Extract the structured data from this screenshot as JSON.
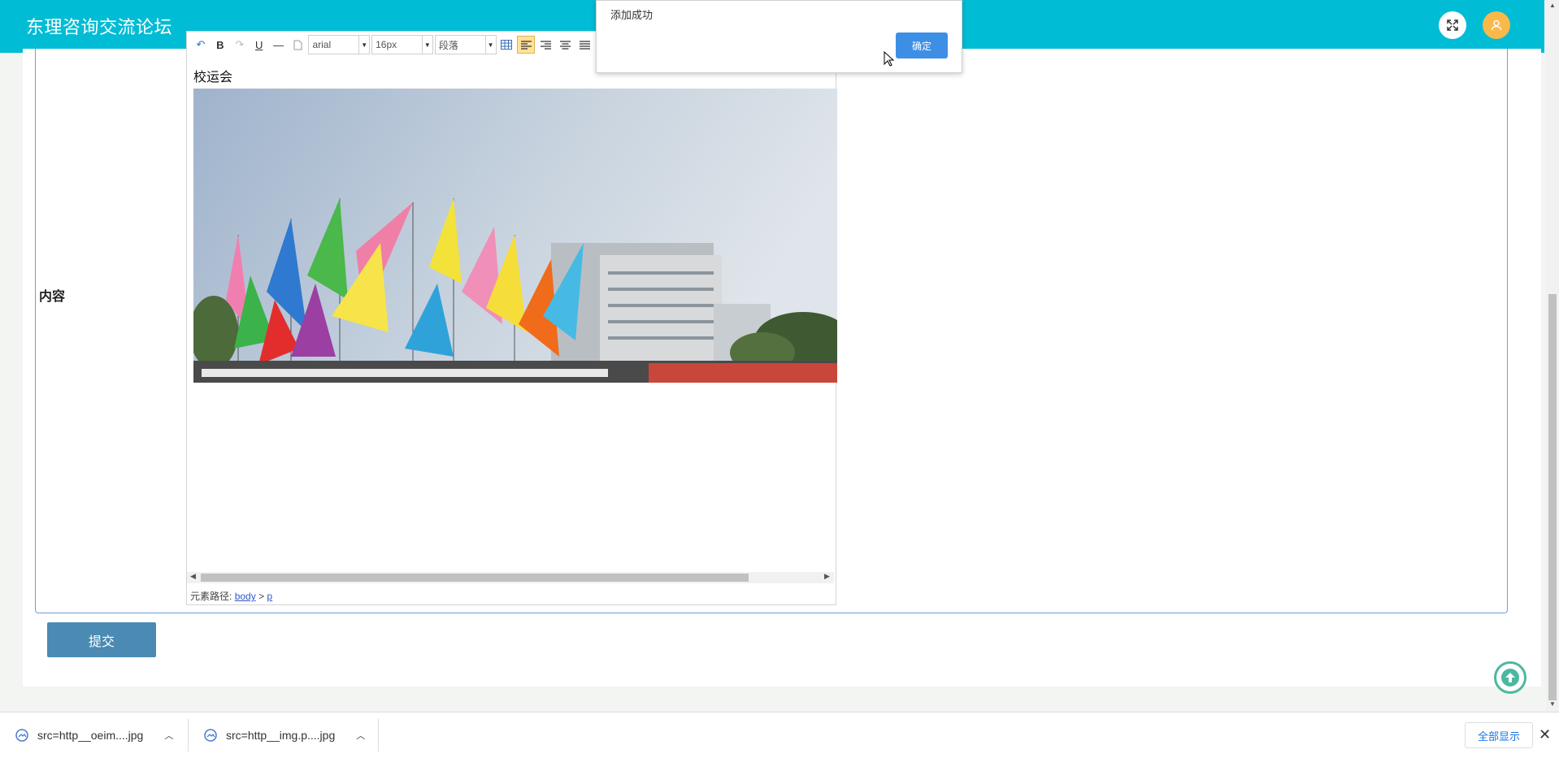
{
  "header": {
    "title": "东理咨询交流论坛"
  },
  "form": {
    "content_label": "内容",
    "submit_label": "提交"
  },
  "editor": {
    "toolbar": {
      "undo_label": "↶",
      "bold_label": "B",
      "redo_label": "↷",
      "underline_label": "U",
      "hr_label": "—",
      "font_family": "arial",
      "font_size": "16px",
      "paragraph": "段落"
    },
    "paragraph_text": "校运会",
    "element_path_label": "元素路径:",
    "path_body": "body",
    "path_sep": ">",
    "path_p": "p"
  },
  "dialog": {
    "message": "添加成功",
    "ok_label": "确定"
  },
  "downloads": {
    "items": [
      {
        "name": "src=http__oeim....jpg"
      },
      {
        "name": "src=http__img.p....jpg"
      }
    ],
    "show_all_label": "全部显示"
  },
  "colors": {
    "header": "#00bcd4",
    "submit": "#4a8ab3",
    "dialog_ok": "#3d8fe6",
    "backtop": "#4bb8a0"
  }
}
